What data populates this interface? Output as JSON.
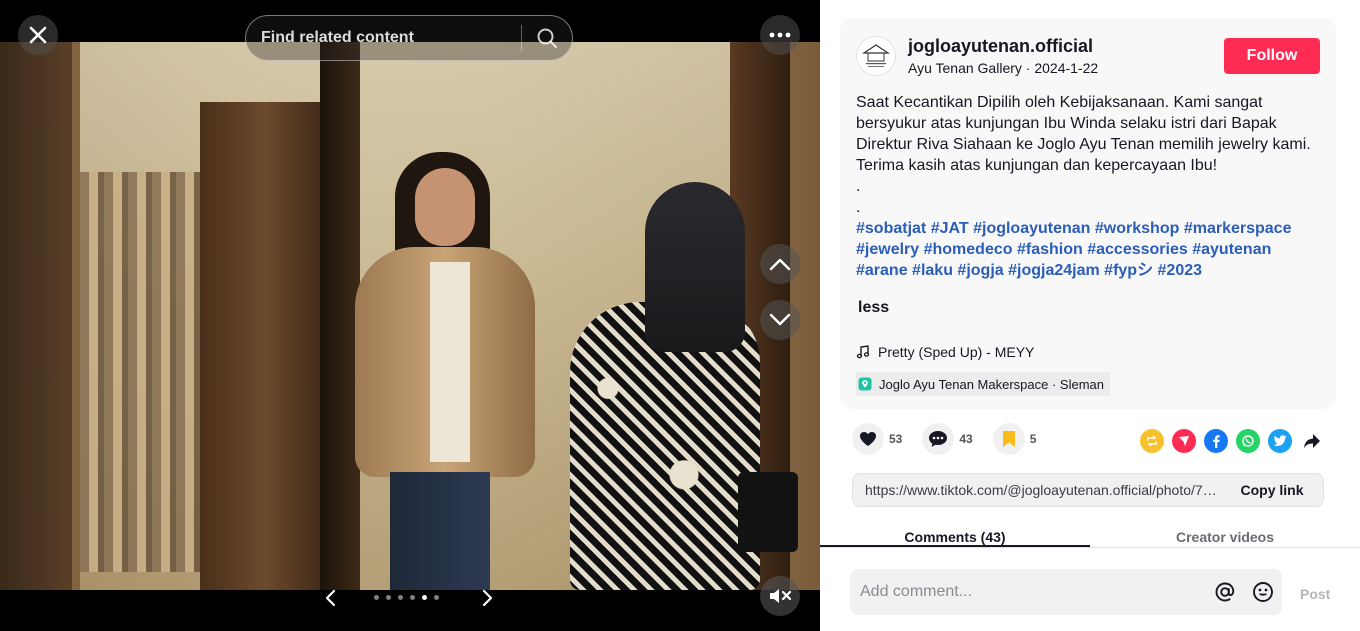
{
  "viewer": {
    "search": {
      "placeholder": "Find related content"
    },
    "slideshow": {
      "total": 6,
      "current_index": 4
    }
  },
  "post": {
    "author": {
      "username": "jogloayutenan.official",
      "display_name": "Ayu Tenan Gallery",
      "date": "2024-1-22"
    },
    "follow_label": "Follow",
    "description_lines": [
      "Saat Kecantikan Dipilih oleh Kebijaksanaan. Kami sangat bersyukur atas kunjungan Ibu Winda selaku istri dari Bapak Direktur Riva Siahaan ke Joglo Ayu Tenan memilih jewelry kami. Terima kasih atas kunjungan dan kepercayaan Ibu!",
      ".",
      "."
    ],
    "hashtags": [
      "#sobatjat",
      "#JAT",
      "#jogloayutenan",
      "#workshop",
      "#markerspace",
      "#jewelry",
      "#homedeco",
      "#fashion",
      "#accessories",
      "#ayutenan",
      "#arane",
      "#laku",
      "#jogja",
      "#jogja24jam",
      "#fypシ",
      "#2023"
    ],
    "less_label": "less",
    "music": "Pretty (Sped Up) - MEYY",
    "location": "Joglo Ayu Tenan Makerspace · Sleman"
  },
  "stats": {
    "likes": "53",
    "comments": "43",
    "saves": "5"
  },
  "share": {
    "link": "https://www.tiktok.com/@jogloayutenan.official/photo/7326740000000000000",
    "copy_label": "Copy link",
    "icons": [
      "repost-icon",
      "send-icon",
      "facebook-icon",
      "whatsapp-icon",
      "twitter-icon",
      "share-arrow-icon"
    ]
  },
  "tabs": [
    {
      "label": "Comments (43)",
      "active": true
    },
    {
      "label": "Creator videos",
      "active": false
    }
  ],
  "comment_input": {
    "placeholder": "Add comment...",
    "post_label": "Post"
  },
  "colors": {
    "follow": "#fe2c55",
    "hashtag": "#2b5db9",
    "repost": "#f6c12b",
    "send": "#fe2c55",
    "facebook": "#1877f2",
    "whatsapp": "#25d366",
    "twitter": "#1da1f2"
  }
}
